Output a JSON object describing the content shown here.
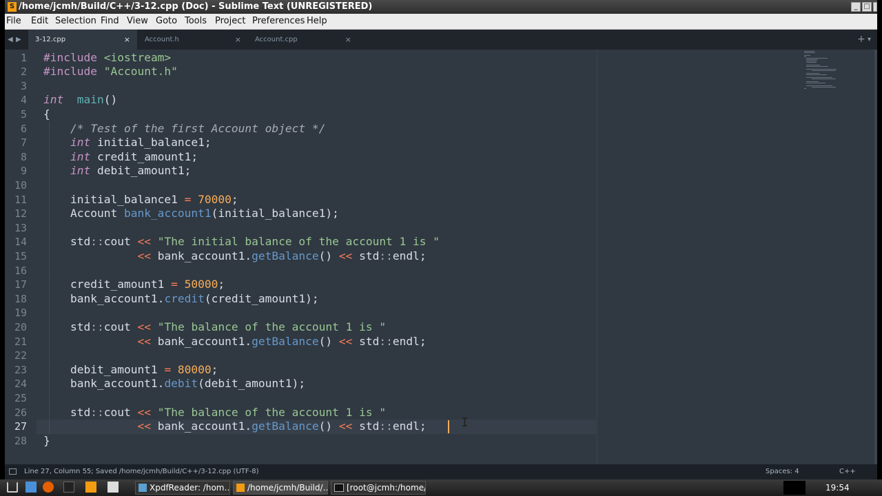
{
  "window": {
    "title": "/home/jcmh/Build/C++/3-12.cpp (Doc) - Sublime Text (UNREGISTERED)"
  },
  "menu": [
    "File",
    "Edit",
    "Selection",
    "Find",
    "View",
    "Goto",
    "Tools",
    "Project",
    "Preferences",
    "Help"
  ],
  "tabs": [
    {
      "label": "3-12.cpp",
      "active": true
    },
    {
      "label": "Account.h",
      "active": false
    },
    {
      "label": "Account.cpp",
      "active": false
    }
  ],
  "tab_close_glyph": "×",
  "new_tab_glyph": "+",
  "code": {
    "current_line": 27,
    "lines": [
      [
        [
          "pp",
          "#include "
        ],
        [
          "str",
          "<iostream>"
        ]
      ],
      [
        [
          "pp",
          "#include "
        ],
        [
          "str",
          "\"Account.h\""
        ]
      ],
      [],
      [
        [
          "kw",
          "int"
        ],
        [
          "",
          "  "
        ],
        [
          "fn",
          "main"
        ],
        [
          "",
          "()"
        ]
      ],
      [
        [
          "",
          "{"
        ]
      ],
      [
        [
          "",
          "    "
        ],
        [
          "cm",
          "/* Test of the first Account object */"
        ]
      ],
      [
        [
          "",
          "    "
        ],
        [
          "kw",
          "int"
        ],
        [
          "",
          " initial_balance1;"
        ]
      ],
      [
        [
          "",
          "    "
        ],
        [
          "kw",
          "int"
        ],
        [
          "",
          " credit_amount1;"
        ]
      ],
      [
        [
          "",
          "    "
        ],
        [
          "kw",
          "int"
        ],
        [
          "",
          " debit_amount1;"
        ]
      ],
      [],
      [
        [
          "",
          "    initial_balance1 "
        ],
        [
          "op",
          "="
        ],
        [
          "num",
          " 70000"
        ],
        [
          "",
          ";"
        ]
      ],
      [
        [
          "",
          "    Account "
        ],
        [
          "mt",
          "bank_account1"
        ],
        [
          "",
          "(initial_balance1);"
        ]
      ],
      [],
      [
        [
          "",
          "    std"
        ],
        [
          "ns",
          "::"
        ],
        [
          "",
          "cout "
        ],
        [
          "op",
          "<<"
        ],
        [
          "str",
          " \"The initial balance of the account 1 is \""
        ]
      ],
      [
        [
          "",
          "              "
        ],
        [
          "op",
          "<<"
        ],
        [
          "",
          " bank_account1."
        ],
        [
          "mt",
          "getBalance"
        ],
        [
          "",
          "() "
        ],
        [
          "op",
          "<<"
        ],
        [
          "",
          " std"
        ],
        [
          "ns",
          "::"
        ],
        [
          "",
          "endl;"
        ]
      ],
      [],
      [
        [
          "",
          "    credit_amount1 "
        ],
        [
          "op",
          "="
        ],
        [
          "num",
          " 50000"
        ],
        [
          "",
          ";"
        ]
      ],
      [
        [
          "",
          "    bank_account1."
        ],
        [
          "mt",
          "credit"
        ],
        [
          "",
          "(credit_amount1);"
        ]
      ],
      [],
      [
        [
          "",
          "    std"
        ],
        [
          "ns",
          "::"
        ],
        [
          "",
          "cout "
        ],
        [
          "op",
          "<<"
        ],
        [
          "str",
          " \"The balance of the account 1 is \""
        ]
      ],
      [
        [
          "",
          "              "
        ],
        [
          "op",
          "<<"
        ],
        [
          "",
          " bank_account1."
        ],
        [
          "mt",
          "getBalance"
        ],
        [
          "",
          "() "
        ],
        [
          "op",
          "<<"
        ],
        [
          "",
          " std"
        ],
        [
          "ns",
          "::"
        ],
        [
          "",
          "endl;"
        ]
      ],
      [],
      [
        [
          "",
          "    debit_amount1 "
        ],
        [
          "op",
          "="
        ],
        [
          "num",
          " 80000"
        ],
        [
          "",
          ";"
        ]
      ],
      [
        [
          "",
          "    bank_account1."
        ],
        [
          "mt",
          "debit"
        ],
        [
          "",
          "(debit_amount1);"
        ]
      ],
      [],
      [
        [
          "",
          "    std"
        ],
        [
          "ns",
          "::"
        ],
        [
          "",
          "cout "
        ],
        [
          "op",
          "<<"
        ],
        [
          "str",
          " \"The balance of the account 1 is \""
        ]
      ],
      [
        [
          "",
          "              "
        ],
        [
          "op",
          "<<"
        ],
        [
          "",
          " bank_account1."
        ],
        [
          "mt",
          "getBalance"
        ],
        [
          "",
          "() "
        ],
        [
          "op",
          "<<"
        ],
        [
          "",
          " std"
        ],
        [
          "ns",
          "::"
        ],
        [
          "",
          "endl;"
        ]
      ],
      [
        [
          "",
          "}"
        ]
      ]
    ]
  },
  "status": {
    "left": "Line 27, Column 55; Saved /home/jcmh/Build/C++/3-12.cpp (UTF-8)",
    "spaces": "Spaces: 4",
    "syntax": "C++"
  },
  "taskbar": {
    "buttons": [
      {
        "label": "XpdfReader: /hom…",
        "icon": "xpdf-icon"
      },
      {
        "label": "/home/jcmh/Build/…",
        "icon": "sublime-icon",
        "active": true
      },
      {
        "label": "[root@jcmh:/home/…",
        "icon": "terminal-icon"
      }
    ],
    "clock": "19:54"
  },
  "colors": {
    "background": "#303841",
    "comment": "#a6acb9",
    "keyword": "#c695c6",
    "string": "#99c794",
    "number": "#f9ae58",
    "operator": "#f97b58",
    "method": "#6699cc",
    "function": "#5fb4b4"
  }
}
